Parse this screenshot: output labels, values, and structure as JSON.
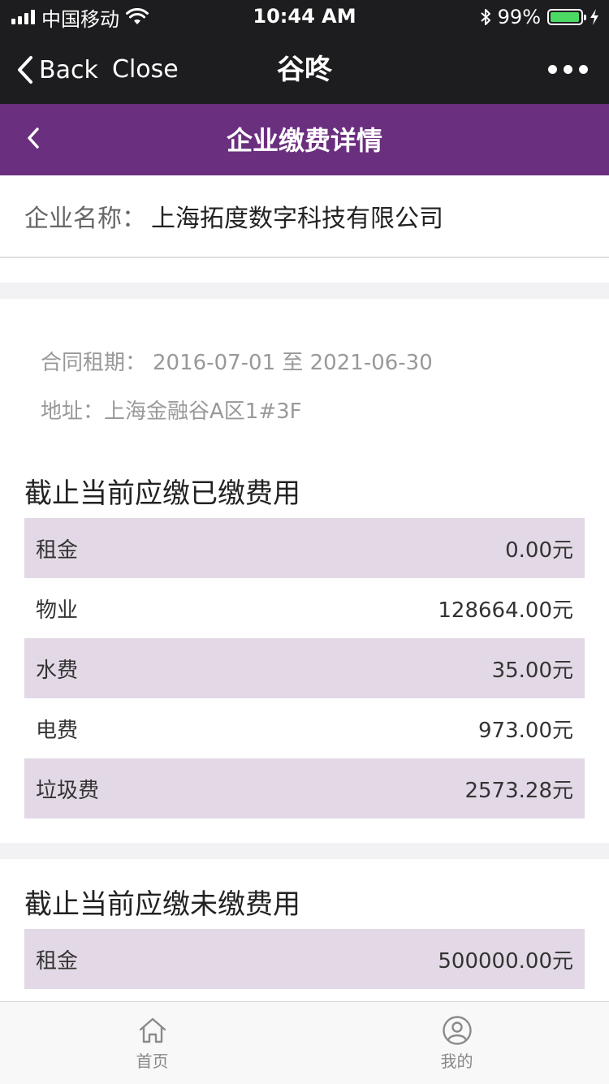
{
  "status_bar": {
    "carrier": "中国移动",
    "time": "10:44 AM",
    "battery": "99%",
    "battery_level": 0.99
  },
  "wechat_nav": {
    "back_label": "Back",
    "close_label": "Close",
    "title": "谷咚"
  },
  "header": {
    "title": "企业缴费详情"
  },
  "company": {
    "label": "企业名称：",
    "value": "上海拓度数字科技有限公司"
  },
  "contract": {
    "label": "合同租期：",
    "value": "2016-07-01 至 2021-06-30"
  },
  "address": {
    "label": "地址：",
    "value": "上海金融谷A区1#3F"
  },
  "paid_section": {
    "title": "截止当前应缴已缴费用",
    "rows": [
      {
        "name": "租金",
        "amount": "0.00元"
      },
      {
        "name": "物业",
        "amount": "128664.00元"
      },
      {
        "name": "水费",
        "amount": "35.00元"
      },
      {
        "name": "电费",
        "amount": "973.00元"
      },
      {
        "name": "垃圾费",
        "amount": "2573.28元"
      }
    ]
  },
  "unpaid_section": {
    "title": "截止当前应缴未缴费用",
    "rows": [
      {
        "name": "租金",
        "amount": "500000.00元"
      }
    ]
  },
  "tabbar": {
    "items": [
      {
        "label": "首页",
        "icon": "home-icon"
      },
      {
        "label": "我的",
        "icon": "profile-icon"
      }
    ]
  },
  "colors": {
    "header_purple": "#6a2f7e",
    "row_shade": "#e3d9e6",
    "battery_green": "#4cd964"
  }
}
